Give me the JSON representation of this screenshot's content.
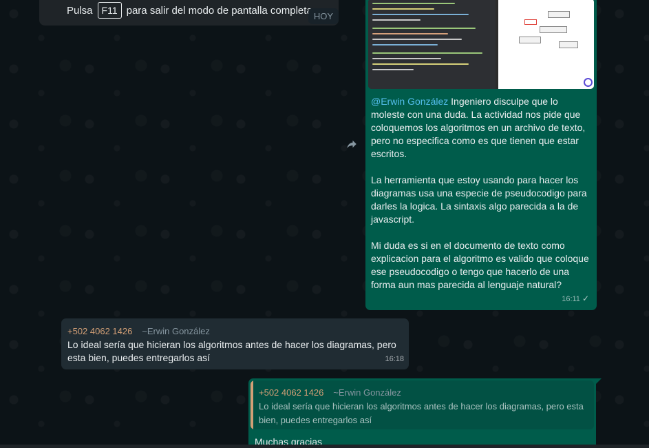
{
  "fullscreen_banner": {
    "prefix": "Pulsa",
    "key": "F11",
    "suffix": "para salir del modo de pantalla completa",
    "date_chip": "HOY"
  },
  "messages": [
    {
      "direction": "outgoing",
      "mention": "@Erwin González",
      "paragraph1": "Ingeniero disculpe que lo moleste con una duda. La actividad nos pide que coloquemos los algoritmos en un archivo de texto, pero no especifica como es que tienen que estar escritos.",
      "paragraph2": "La herramienta que estoy usando para hacer los diagramas usa una especie de pseudocodigo para darles la logica. La sintaxis algo parecida a la de javascript.",
      "paragraph3": "Mi duda es si en el documento de texto como explicacion para el algoritmo es valido que coloque ese pseudocodigo o tengo que hacerlo de una forma aun mas parecida al lenguaje natural?",
      "time": "16:11",
      "status": "✓",
      "image_icon": "screenshot-thumbnail"
    },
    {
      "direction": "incoming",
      "sender_phone": "+502 4062 1426",
      "sender_name": "~Erwin González",
      "text": "Lo ideal sería que hicieran los algoritmos antes de hacer los diagramas, pero esta bien, puedes entregarlos así",
      "time": "16:18"
    },
    {
      "direction": "outgoing",
      "quoted_phone": "+502 4062 1426",
      "quoted_name": "~Erwin González",
      "quoted_text": "Lo ideal sería que hicieran los algoritmos antes de hacer los diagramas, pero esta bien, puedes entregarlos así",
      "text": "Muchas gracias"
    }
  ],
  "icons": {
    "forward": "forward-arrow-icon"
  },
  "colors": {
    "background": "#0c1317",
    "outgoing_bubble": "#005c4b",
    "incoming_bubble": "#202c33",
    "mention": "#53bdeb",
    "sender": "#d29f76"
  }
}
